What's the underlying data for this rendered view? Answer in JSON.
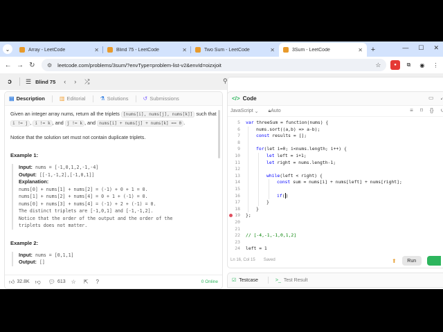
{
  "browser": {
    "tabs": [
      {
        "label": "Array - LeetCode",
        "active": false
      },
      {
        "label": "Blind 75 - LeetCode",
        "active": false
      },
      {
        "label": "Two Sum - LeetCode",
        "active": false
      },
      {
        "label": "3Sum - LeetCode",
        "active": true
      }
    ],
    "new_tab": "+",
    "url": "leetcode.com/problems/3sum/?envType=problem-list-v2&envId=oizxjoit"
  },
  "lc_nav": {
    "list_name": "Blind 75",
    "streak_count": "0"
  },
  "left_tabs": {
    "description": "Description",
    "editorial": "Editorial",
    "solutions": "Solutions",
    "submissions": "Submissions"
  },
  "problem": {
    "intro_1": "Given an integer array nums, return all the triplets",
    "triplet": "[nums[i], nums[j], nums[k]]",
    "intro_2": "such that",
    "cond_1": "i != j",
    "cond_2": "i != k",
    "cond_3": "j != k",
    "sum_cond": "nums[i] + nums[j] + nums[k] == 0",
    "and_word": ", and",
    "notice": "Notice that the solution set must not contain duplicate triplets.",
    "example1_title": "Example 1:",
    "example1_input_label": "Input:",
    "example1_input": "nums = [-1,0,1,2,-1,-4]",
    "example1_output_label": "Output:",
    "example1_output": "[[-1,-1,2],[-1,0,1]]",
    "example1_expl_label": "Explanation:",
    "example1_expl": [
      "nums[0] + nums[1] + nums[2] = (-1) + 0 + 1 = 0.",
      "nums[1] + nums[2] + nums[4] = 0 + 1 + (-1) = 0.",
      "nums[0] + nums[3] + nums[4] = (-1) + 2 + (-1) = 0.",
      "The distinct triplets are [-1,0,1] and [-1,-1,2].",
      "Notice that the order of the output and the order of the",
      "triplets does not matter."
    ],
    "example2_title": "Example 2:",
    "example2_input_label": "Input:",
    "example2_input": "nums = [0,1,1]",
    "example2_output_label": "Output:",
    "example2_output": "[]"
  },
  "left_footer": {
    "likes": "32.8K",
    "comments": "613",
    "online": "0 Online"
  },
  "code_panel": {
    "title": "Code",
    "language": "JavaScript",
    "mode": "Auto",
    "status_pos": "Ln 16, Col 15",
    "status_saved": "Saved",
    "run_label": "Run",
    "lines": [
      {
        "n": "5",
        "text": "var threeSum = function(nums) {",
        "indent": 0
      },
      {
        "n": "6",
        "text": "nums.sort((a,b) => a-b);",
        "indent": 1
      },
      {
        "n": "7",
        "text": "const results = [];",
        "indent": 1
      },
      {
        "n": "8",
        "text": "",
        "indent": 0
      },
      {
        "n": "9",
        "text": "for(let i=0; i<nums.length; i++) {",
        "indent": 1
      },
      {
        "n": "10",
        "text": "let left = i+1;",
        "indent": 2
      },
      {
        "n": "11",
        "text": "let right = nums.length-1;",
        "indent": 2
      },
      {
        "n": "12",
        "text": "",
        "indent": 0
      },
      {
        "n": "13",
        "text": "while(left < right) {",
        "indent": 2
      },
      {
        "n": "14",
        "text": "const sum = nums[i] + nums[left] + nums[right];",
        "indent": 3
      },
      {
        "n": "15",
        "text": "",
        "indent": 0
      },
      {
        "n": "16",
        "text": "if()",
        "indent": 3
      },
      {
        "n": "17",
        "text": "}",
        "indent": 2
      },
      {
        "n": "18",
        "text": "}",
        "indent": 1
      },
      {
        "n": "19",
        "text": "};",
        "indent": 0
      },
      {
        "n": "20",
        "text": "",
        "indent": 0
      },
      {
        "n": "21",
        "text": "",
        "indent": 0
      },
      {
        "n": "22",
        "text": "// [-4,-1,-1,0,1,2]",
        "indent": 0
      },
      {
        "n": "23",
        "text": "",
        "indent": 0
      },
      {
        "n": "24",
        "text": "left = 1",
        "indent": 0
      }
    ]
  },
  "console": {
    "testcase": "Testcase",
    "test_result": "Test Result"
  }
}
